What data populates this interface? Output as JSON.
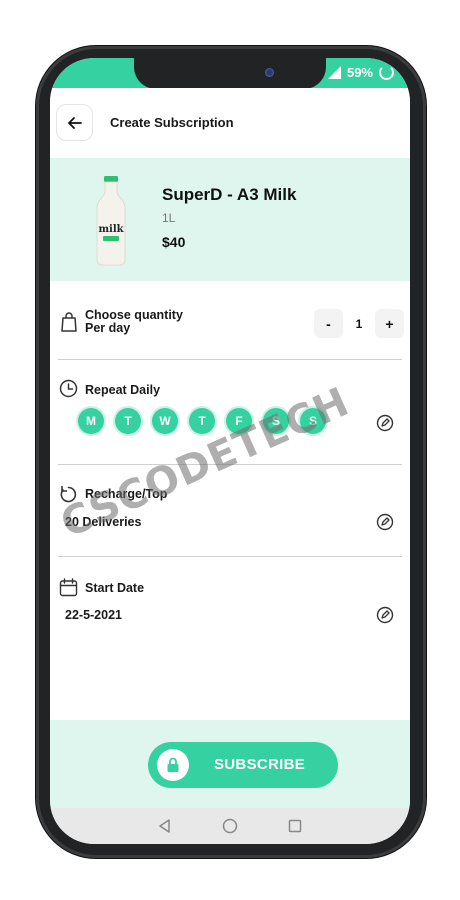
{
  "status_bar": {
    "network": "4G",
    "battery": "59%"
  },
  "header": {
    "title": "Create Subscription"
  },
  "product": {
    "name": "SuperD - A3 Milk",
    "size": "1L",
    "price": "$40",
    "label": "milk"
  },
  "quantity": {
    "label_line1": "Choose quantity",
    "label_line2": "Per day",
    "value": "1",
    "minus": "-",
    "plus": "+"
  },
  "repeat": {
    "label": "Repeat Daily",
    "days": [
      "M",
      "T",
      "W",
      "T",
      "F",
      "S",
      "S"
    ]
  },
  "recharge": {
    "label": "Recharge/Top",
    "value": "20 Deliveries"
  },
  "start_date": {
    "label": "Start Date",
    "value": "22-5-2021"
  },
  "subscribe": {
    "label": "SUBSCRIBE"
  },
  "watermark": "CSCODETECH",
  "colors": {
    "accent": "#35d1a1",
    "accent_light": "#dff6ee",
    "text": "#1a1a1a"
  }
}
